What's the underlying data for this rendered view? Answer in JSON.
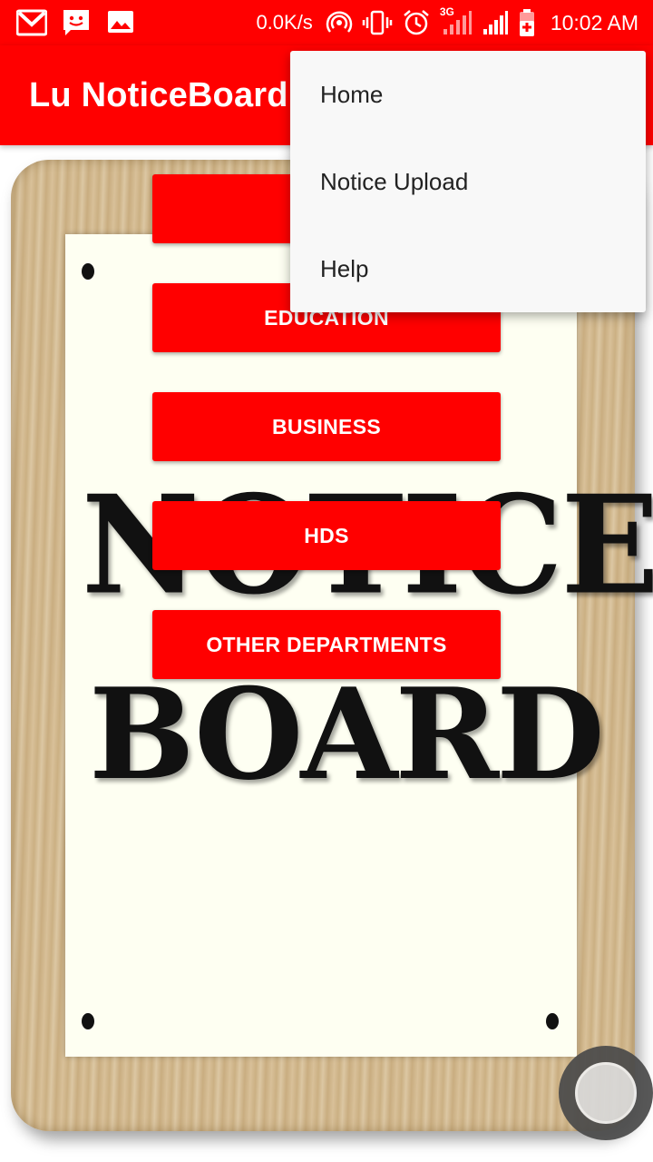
{
  "status_bar": {
    "left_icons": [
      "gmail-icon",
      "messages-icon",
      "gallery-icon"
    ],
    "net_speed": "0.0K/s",
    "network_label": "3G",
    "time": "10:02 AM"
  },
  "app_bar": {
    "title": "Lu NoticeBoard"
  },
  "buttons": [
    {
      "label": ""
    },
    {
      "label": "EDUCATION"
    },
    {
      "label": "BUSINESS"
    },
    {
      "label": "HDS"
    },
    {
      "label": "OTHER DEPARTMENTS"
    }
  ],
  "board_image": {
    "line1": "NOTICE",
    "line2": "BOARD"
  },
  "overflow_menu": {
    "items": [
      {
        "label": "Home"
      },
      {
        "label": "Notice Upload"
      },
      {
        "label": "Help"
      }
    ]
  },
  "colors": {
    "primary": "#ff0000",
    "menu_bg": "#f8f8f8",
    "button_text": "#ffffff"
  }
}
